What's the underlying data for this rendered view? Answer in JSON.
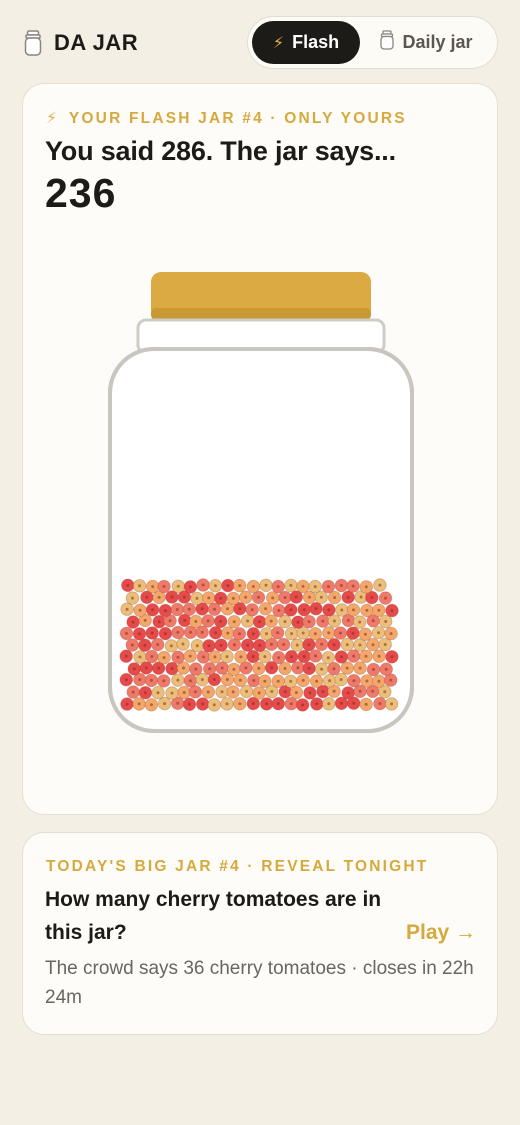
{
  "header": {
    "title": "DA JAR",
    "modes": {
      "flash_label": "Flash",
      "daily_label": "Daily jar",
      "active": "Flash"
    }
  },
  "flash_card": {
    "kicker": "YOUR FLASH JAR #4 · ONLY YOURS",
    "said_prefix": "You said ",
    "guess": "286",
    "said_suffix": ". The jar says...",
    "actual": "236",
    "jar": {
      "lid_color": "#dcaa42",
      "item_colors": [
        "#e54b4b",
        "#ee7a6a",
        "#f2a86a",
        "#e9bf7a"
      ]
    }
  },
  "daily_card": {
    "kicker": "TODAY'S BIG JAR #4 · REVEAL TONIGHT",
    "question": "How many cherry tomatoes are in this jar?",
    "play_label": "Play →",
    "crowd_text": "The crowd says 36 cherry tomatoes · closes in 22h 24m"
  },
  "colors": {
    "background": "#f4efe4",
    "accent": "#d6a93d",
    "ink": "#1d1b17",
    "muted": "#6a665f"
  }
}
